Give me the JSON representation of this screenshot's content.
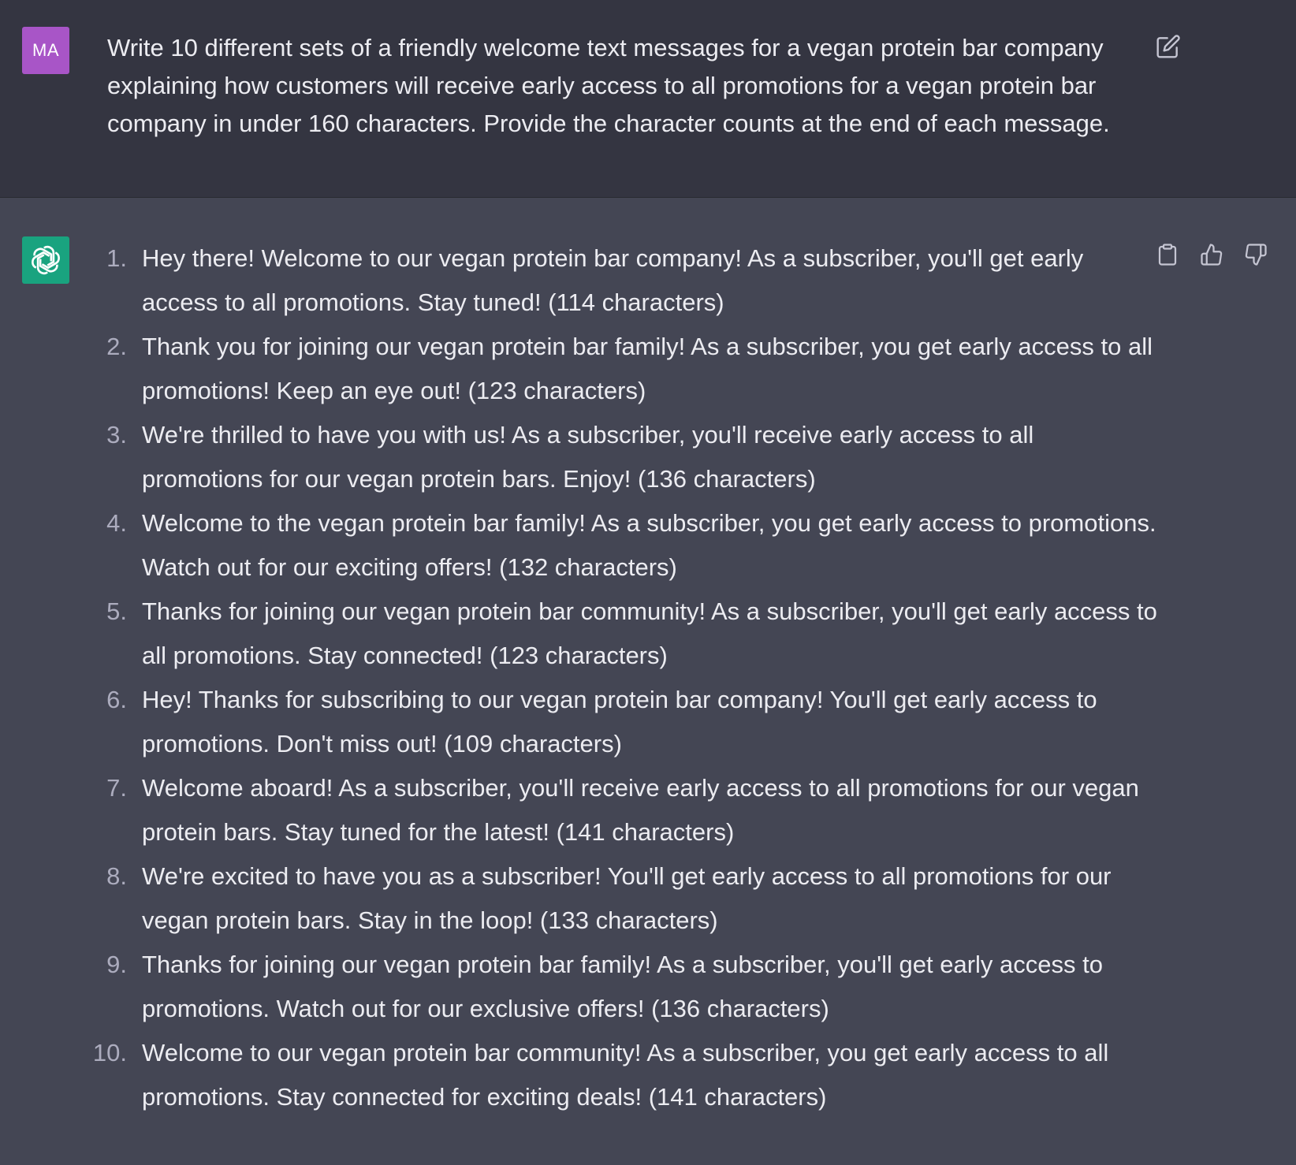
{
  "user_message": {
    "avatar_initials": "MA",
    "avatar_color": "#a855c7",
    "text": "Write 10 different sets of a friendly welcome text messages for a vegan protein bar company explaining how customers will receive early access to all promotions for a vegan protein bar company in under 160 characters. Provide the character counts at the end of each message.",
    "edit_icon": "edit-icon"
  },
  "assistant_message": {
    "avatar_icon": "openai-logo-icon",
    "avatar_color": "#19a37f",
    "actions": [
      "copy-icon",
      "thumbs-up-icon",
      "thumbs-down-icon"
    ],
    "items": [
      {
        "num": "1.",
        "text": "Hey there! Welcome to our vegan protein bar company! As a subscriber, you'll get early access to all promotions. Stay tuned! (114 characters)"
      },
      {
        "num": "2.",
        "text": "Thank you for joining our vegan protein bar family! As a subscriber, you get early access to all promotions! Keep an eye out! (123 characters)"
      },
      {
        "num": "3.",
        "text": "We're thrilled to have you with us! As a subscriber, you'll receive early access to all promotions for our vegan protein bars. Enjoy! (136 characters)"
      },
      {
        "num": "4.",
        "text": "Welcome to the vegan protein bar family! As a subscriber, you get early access to promotions. Watch out for our exciting offers! (132 characters)"
      },
      {
        "num": "5.",
        "text": "Thanks for joining our vegan protein bar community! As a subscriber, you'll get early access to all promotions. Stay connected! (123 characters)"
      },
      {
        "num": "6.",
        "text": "Hey! Thanks for subscribing to our vegan protein bar company! You'll get early access to promotions. Don't miss out! (109 characters)"
      },
      {
        "num": "7.",
        "text": "Welcome aboard! As a subscriber, you'll receive early access to all promotions for our vegan protein bars. Stay tuned for the latest! (141 characters)"
      },
      {
        "num": "8.",
        "text": "We're excited to have you as a subscriber! You'll get early access to all promotions for our vegan protein bars. Stay in the loop! (133 characters)"
      },
      {
        "num": "9.",
        "text": "Thanks for joining our vegan protein bar family! As a subscriber, you'll get early access to promotions. Watch out for our exclusive offers! (136 characters)"
      },
      {
        "num": "10.",
        "text": "Welcome to our vegan protein bar community! As a subscriber, you get early access to all promotions. Stay connected for exciting deals! (141 characters)"
      }
    ]
  }
}
